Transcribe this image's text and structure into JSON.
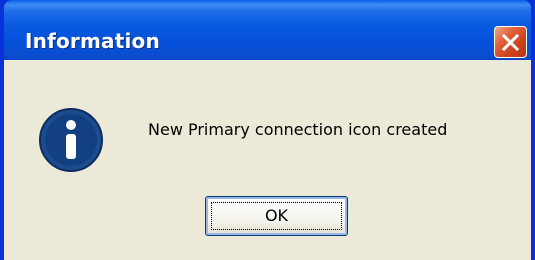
{
  "window": {
    "title": "Information",
    "close_icon": "close-icon"
  },
  "dialog": {
    "icon": "information-icon",
    "message": "New Primary connection icon created",
    "ok_label": "OK"
  },
  "colors": {
    "titlebar": "#0a5be0",
    "frame": "#0831d9",
    "client_background": "#ece9d8",
    "close_button": "#e0603b",
    "info_icon": "#1b4c8e"
  }
}
